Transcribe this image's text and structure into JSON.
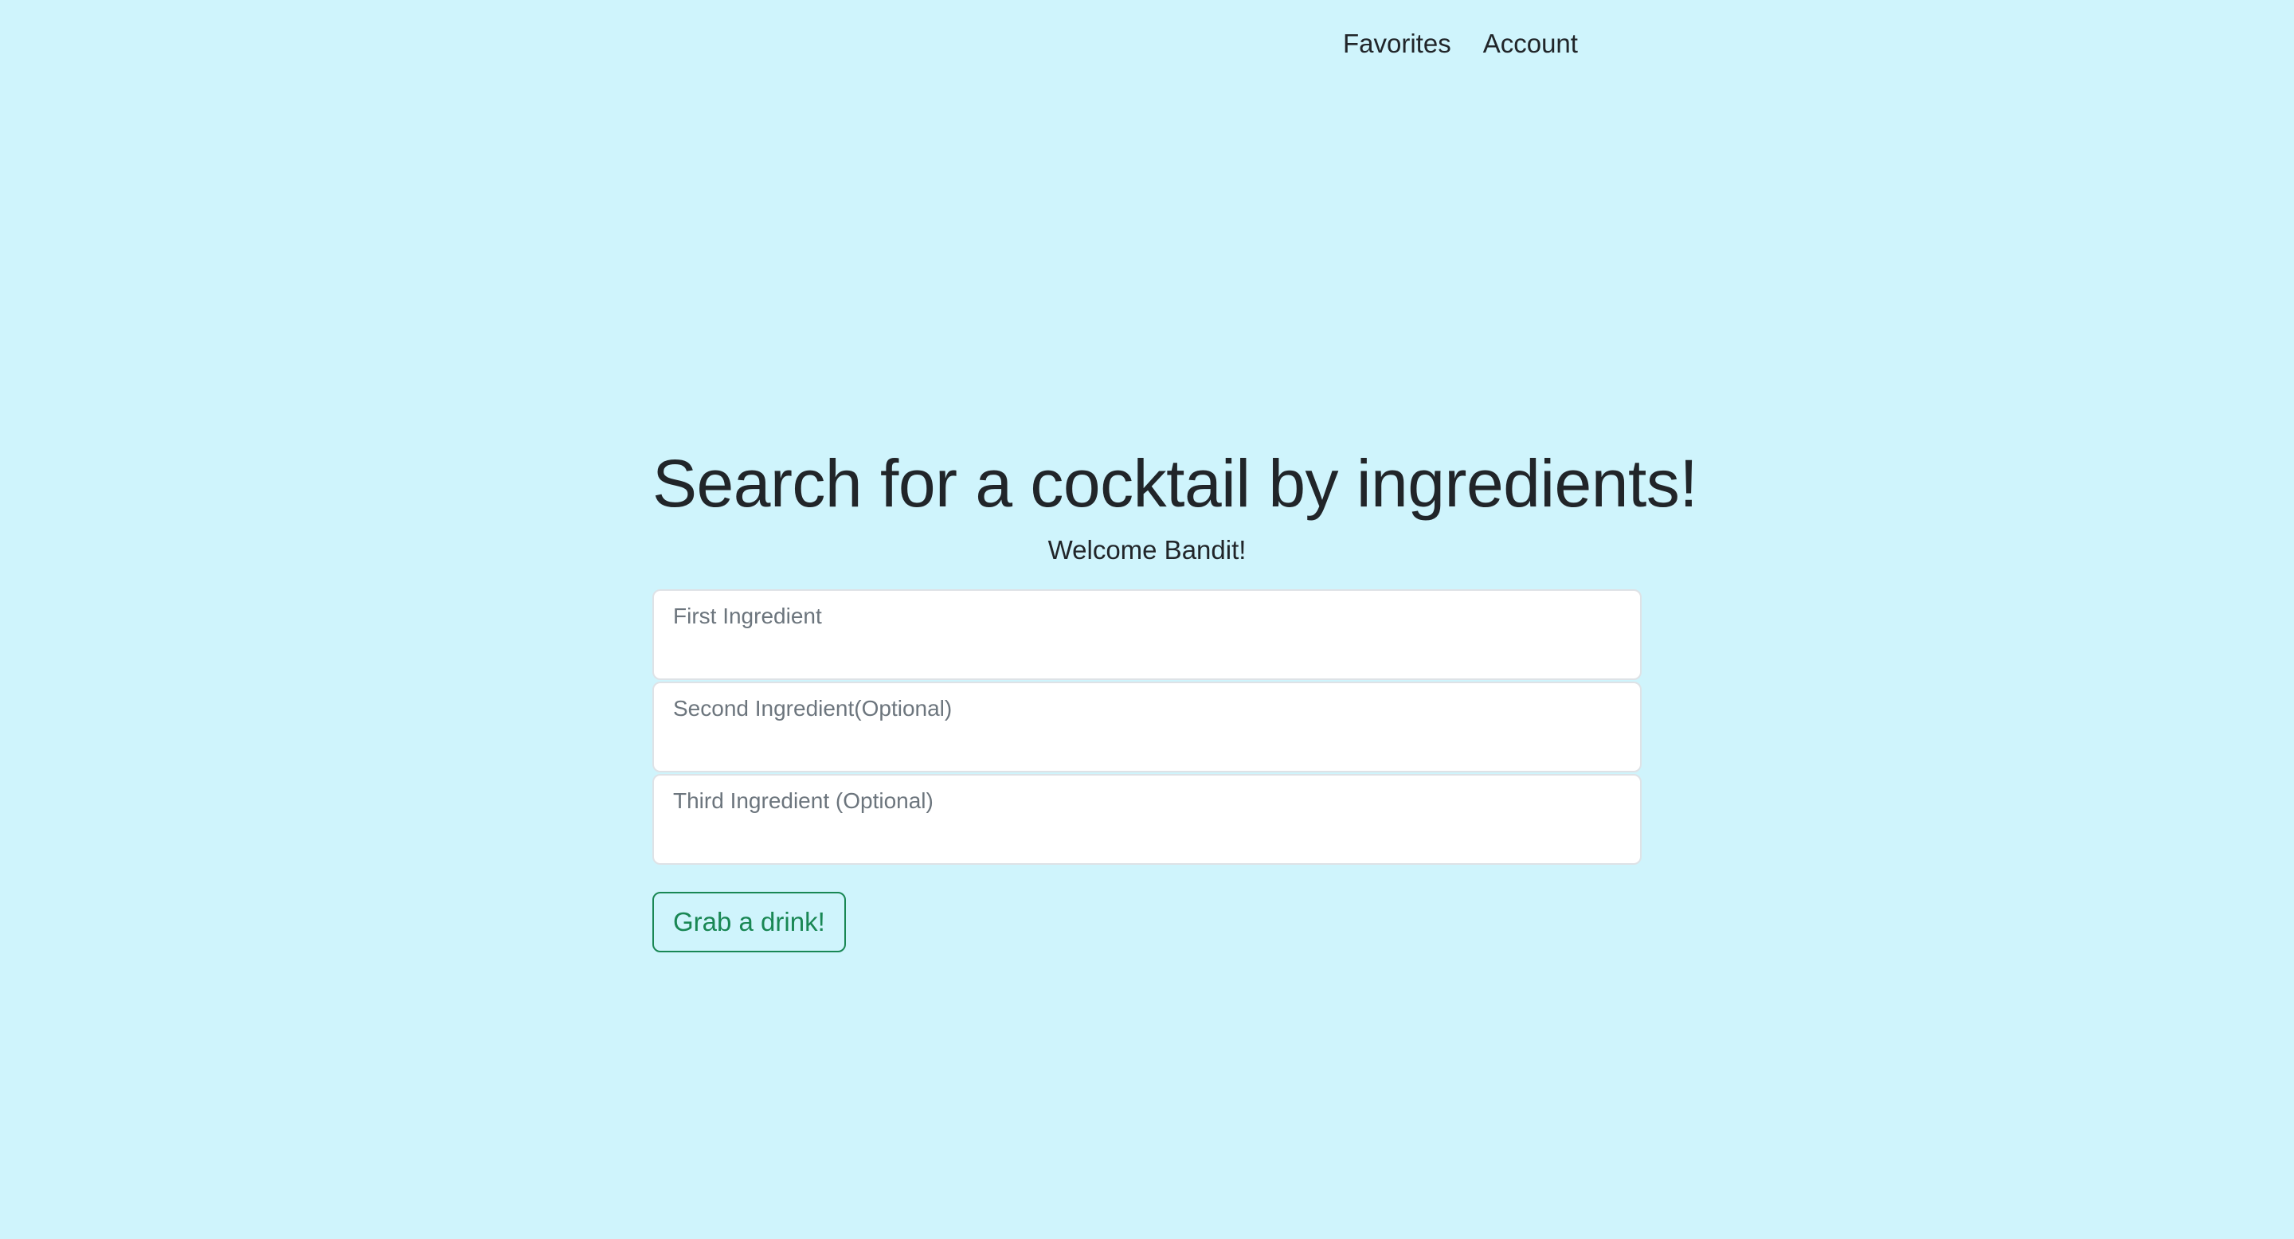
{
  "nav": {
    "items": [
      {
        "label": "Favorites"
      },
      {
        "label": "Account"
      }
    ]
  },
  "main": {
    "title": "Search for a cocktail by ingredients!",
    "welcome": "Welcome Bandit!",
    "fields": [
      {
        "label": "First Ingredient",
        "value": ""
      },
      {
        "label": "Second Ingredient(Optional)",
        "value": ""
      },
      {
        "label": "Third Ingredient (Optional)",
        "value": ""
      }
    ],
    "submit_label": "Grab a drink!"
  },
  "colors": {
    "background": "#cff4fc",
    "button_accent": "#198754",
    "text": "#212529"
  }
}
